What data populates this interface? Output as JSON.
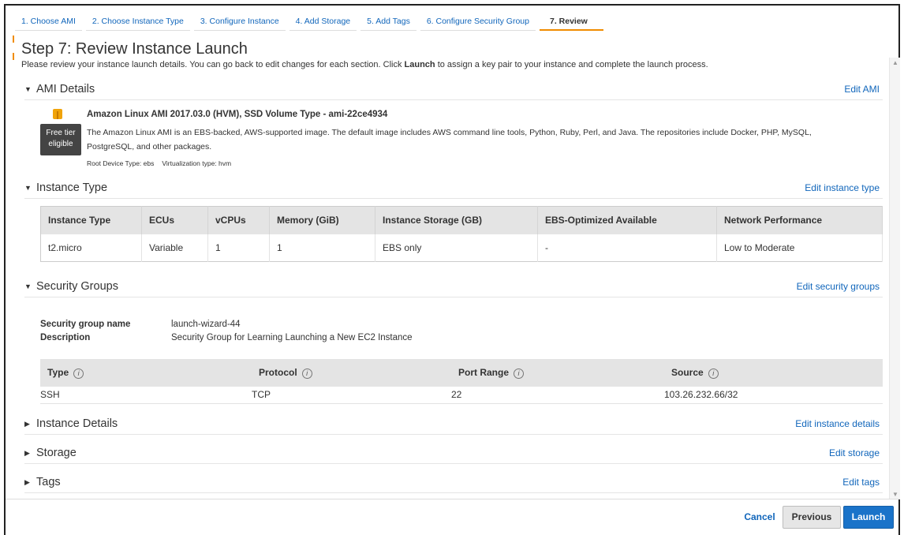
{
  "wizard": {
    "tabs": [
      "1. Choose AMI",
      "2. Choose Instance Type",
      "3. Configure Instance",
      "4. Add Storage",
      "5. Add Tags",
      "6. Configure Security Group",
      "7. Review"
    ],
    "active_index": 6
  },
  "page": {
    "title": "Step 7: Review Instance Launch",
    "intro_before": "Please review your instance launch details. You can go back to edit changes for each section. Click ",
    "intro_bold": "Launch",
    "intro_after": " to assign a key pair to your instance and complete the launch process."
  },
  "ami": {
    "section_title": "AMI Details",
    "edit_label": "Edit AMI",
    "free_tier_line1": "Free tier",
    "free_tier_line2": "eligible",
    "name": "Amazon Linux AMI 2017.03.0 (HVM), SSD Volume Type - ami-22ce4934",
    "description": "The Amazon Linux AMI is an EBS-backed, AWS-supported image. The default image includes AWS command line tools, Python, Ruby, Perl, and Java. The repositories include Docker, PHP, MySQL, PostgreSQL, and other packages.",
    "root_device": "Root Device Type: ebs",
    "virtualization": "Virtualization type: hvm"
  },
  "instance_type": {
    "section_title": "Instance Type",
    "edit_label": "Edit instance type",
    "columns": [
      "Instance Type",
      "ECUs",
      "vCPUs",
      "Memory (GiB)",
      "Instance Storage (GB)",
      "EBS-Optimized Available",
      "Network Performance"
    ],
    "row": [
      "t2.micro",
      "Variable",
      "1",
      "1",
      "EBS only",
      "-",
      "Low to Moderate"
    ]
  },
  "security_groups": {
    "section_title": "Security Groups",
    "edit_label": "Edit security groups",
    "name_key": "Security group name",
    "name_value": "launch-wizard-44",
    "desc_key": "Description",
    "desc_value": "Security Group for Learning Launching a New EC2 Instance",
    "columns": [
      "Type",
      "Protocol",
      "Port Range",
      "Source"
    ],
    "row": [
      "SSH",
      "TCP",
      "22",
      "103.26.232.66/32"
    ]
  },
  "instance_details": {
    "section_title": "Instance Details",
    "edit_label": "Edit instance details"
  },
  "storage": {
    "section_title": "Storage",
    "edit_label": "Edit storage"
  },
  "tags": {
    "section_title": "Tags",
    "edit_label": "Edit tags"
  },
  "footer": {
    "cancel": "Cancel",
    "previous": "Previous",
    "launch": "Launch"
  },
  "icons": {
    "expanded": "caret-down-icon",
    "collapsed": "caret-right-icon",
    "info": "info-icon",
    "ami": "cube-icon"
  },
  "colors": {
    "link": "#1166bb",
    "accent": "#f08c00",
    "launch": "#1a73c9"
  }
}
